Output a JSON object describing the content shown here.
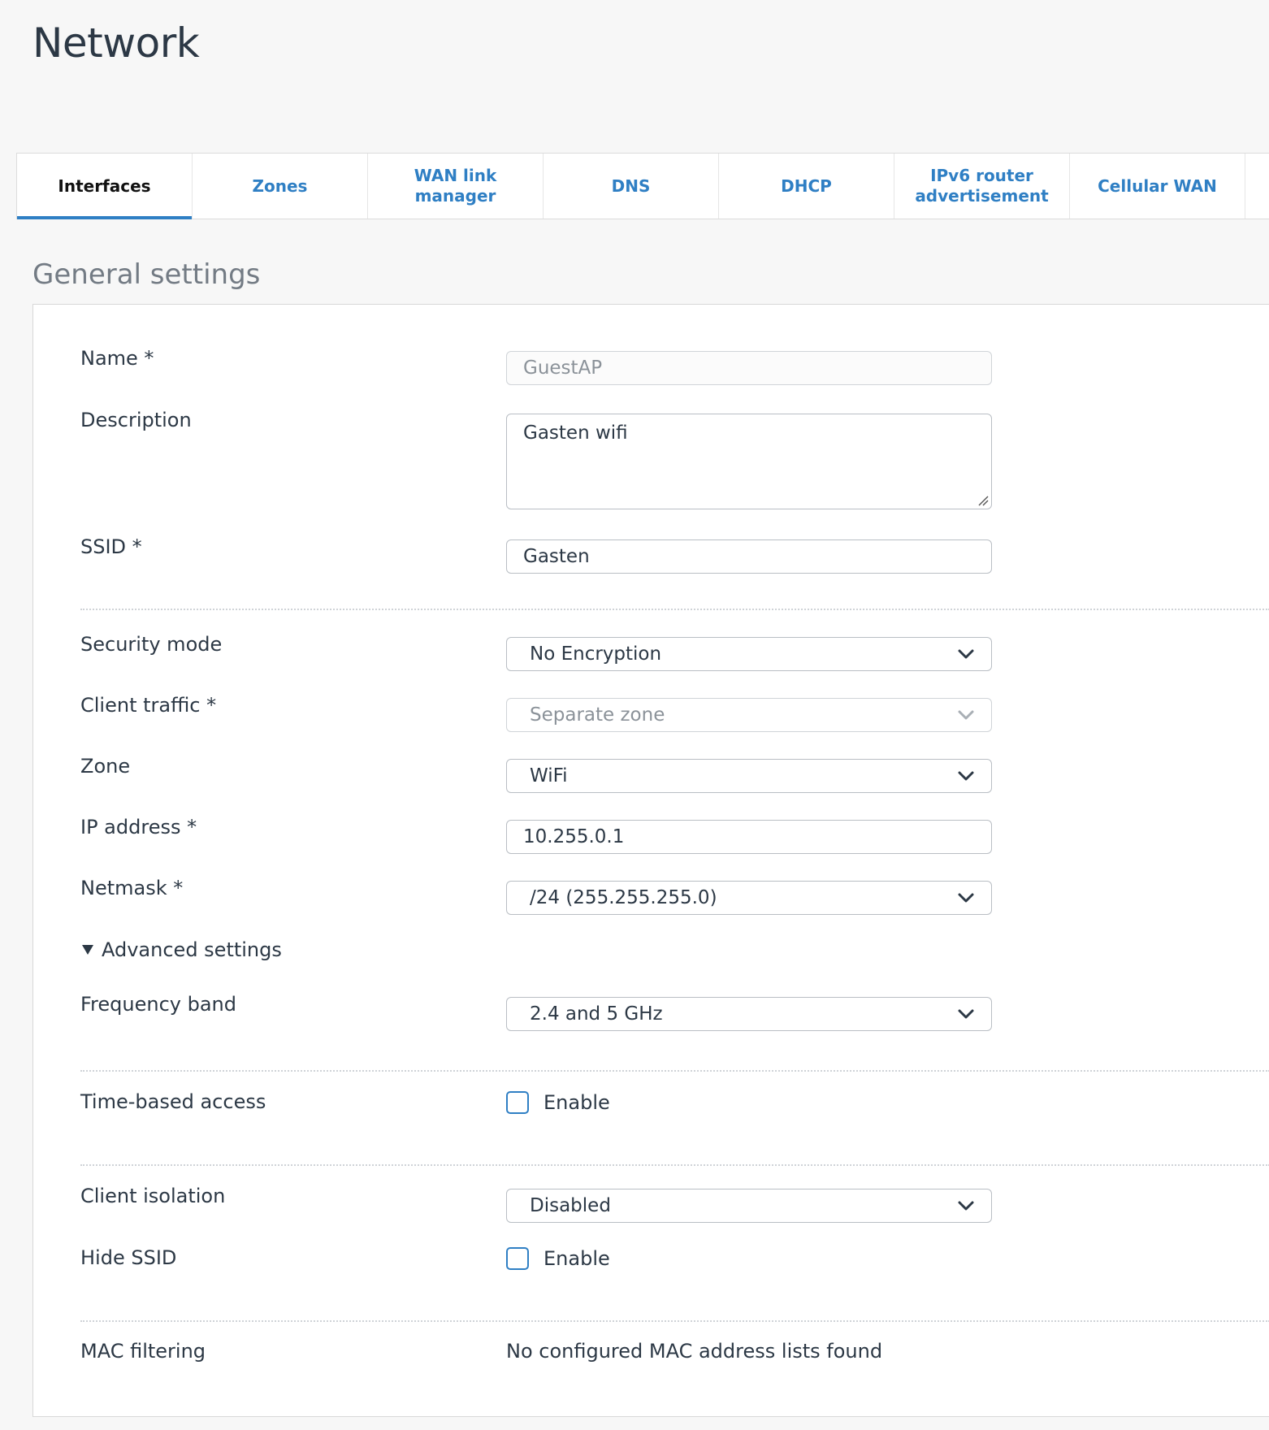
{
  "page": {
    "title": "Network"
  },
  "tabs": [
    {
      "label": "Interfaces"
    },
    {
      "label": "Zones"
    },
    {
      "label": "WAN link manager"
    },
    {
      "label": "DNS"
    },
    {
      "label": "DHCP"
    },
    {
      "label": "IPv6 router advertisement"
    },
    {
      "label": "Cellular WAN"
    }
  ],
  "active_tab": "Interfaces",
  "section": {
    "title": "General settings"
  },
  "form": {
    "name": {
      "label": "Name *",
      "value": "GuestAP"
    },
    "description": {
      "label": "Description",
      "value": "Gasten wifi"
    },
    "ssid": {
      "label": "SSID *",
      "value": "Gasten"
    },
    "security_mode": {
      "label": "Security mode",
      "value": "No Encryption"
    },
    "client_traffic": {
      "label": "Client traffic *",
      "value": "Separate zone"
    },
    "zone": {
      "label": "Zone",
      "value": "WiFi"
    },
    "ip_address": {
      "label": "IP address *",
      "value": "10.255.0.1"
    },
    "netmask": {
      "label": "Netmask *",
      "value": "/24 (255.255.255.0)"
    },
    "advanced": {
      "label": "Advanced settings"
    },
    "frequency_band": {
      "label": "Frequency band",
      "value": "2.4 and 5 GHz"
    },
    "time_based_access": {
      "label": "Time-based access",
      "checkbox_label": "Enable"
    },
    "client_isolation": {
      "label": "Client isolation",
      "value": "Disabled"
    },
    "hide_ssid": {
      "label": "Hide SSID",
      "checkbox_label": "Enable"
    },
    "mac_filtering": {
      "label": "MAC filtering",
      "value": "No configured MAC address lists found"
    }
  },
  "colors": {
    "accent": "#2f7fc4",
    "text": "#2c3845",
    "muted": "#737b84"
  }
}
